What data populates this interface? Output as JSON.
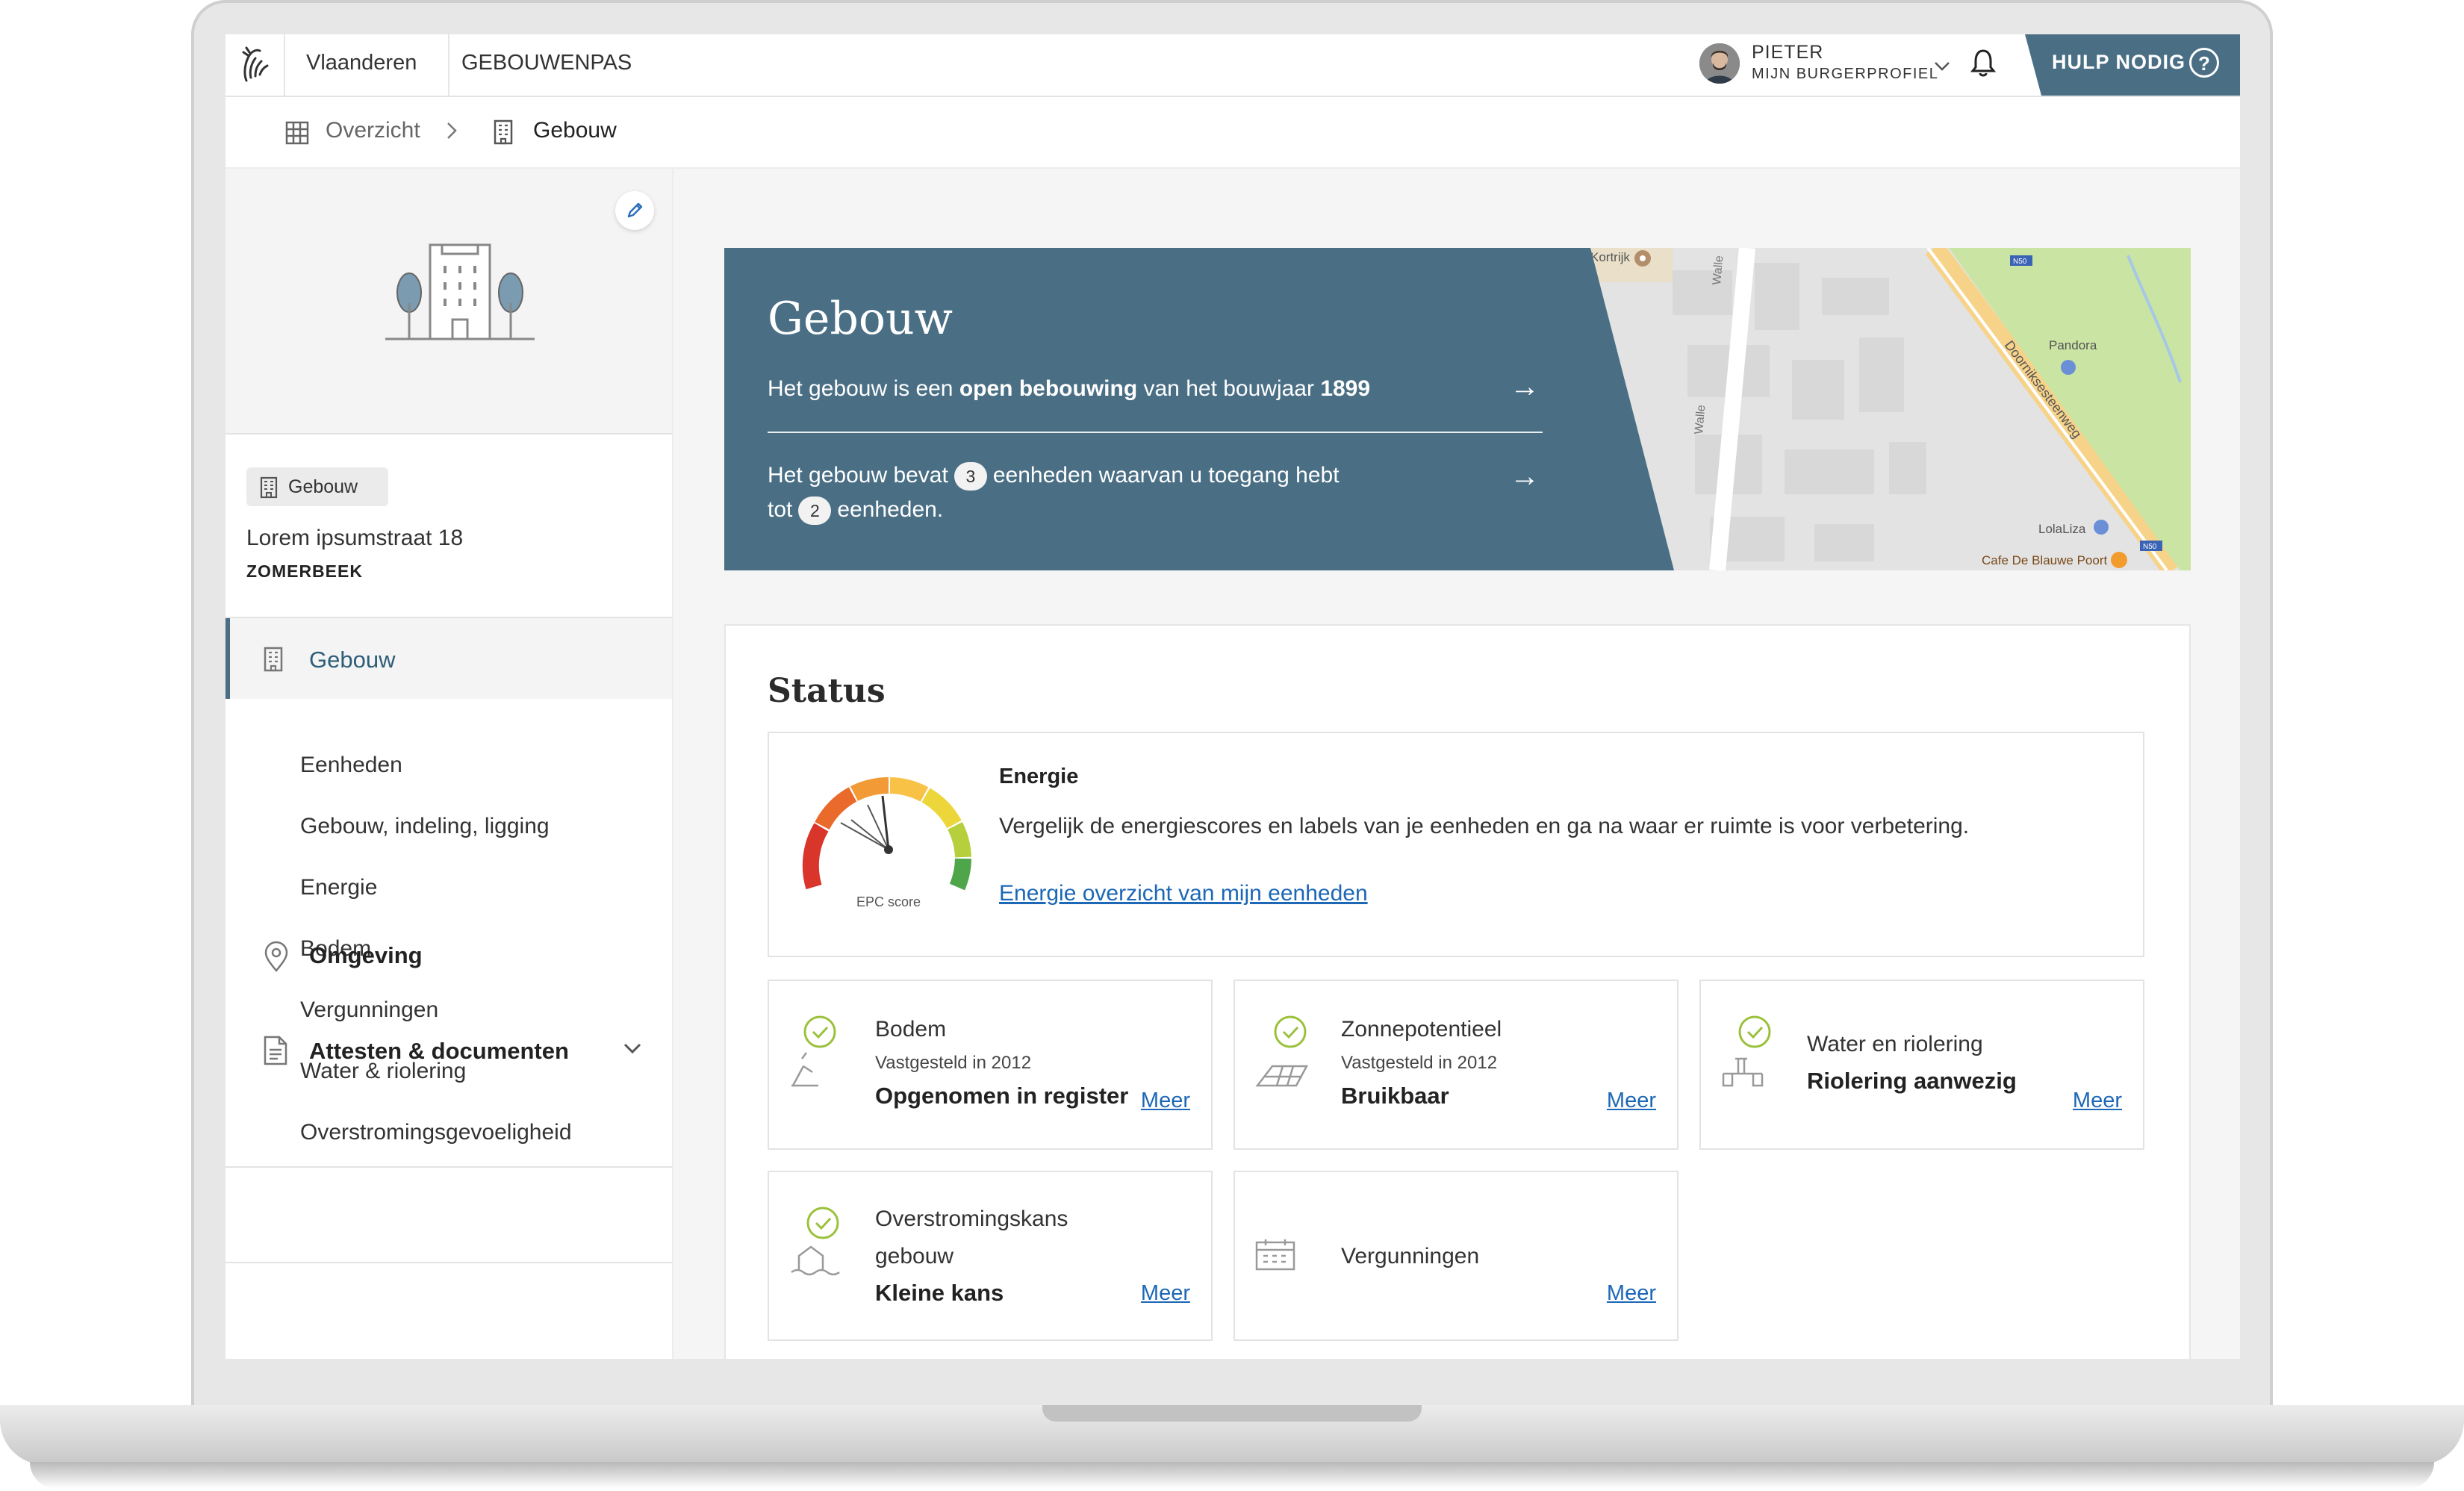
{
  "header": {
    "brand": "Vlaanderen",
    "app_name": "GEBOUWENPAS",
    "user_name": "PIETER",
    "user_profile": "MIJN BURGERPROFIEL",
    "help_label": "HULP NODIG",
    "help_icon": "?"
  },
  "breadcrumb": {
    "items": [
      {
        "label": "Overzicht",
        "icon": "grid-icon"
      },
      {
        "label": "Gebouw",
        "icon": "building-icon"
      }
    ]
  },
  "sidebar": {
    "tag": "Gebouw",
    "address": "Lorem ipsumstraat 18",
    "city": "ZOMERBEEK",
    "active_item": "Gebouw",
    "sub_items": [
      "Eenheden",
      "Gebouw, indeling, ligging",
      "Energie",
      "Bodem",
      "Vergunningen",
      "Water & riolering",
      "Overstromingsgevoeligheid"
    ],
    "omgeving": "Omgeving",
    "attesten": "Attesten & documenten"
  },
  "banner": {
    "title": "Gebouw",
    "line1_pre": "Het gebouw is een ",
    "line1_bold": "open bebouwing",
    "line1_mid": " van het bouwjaar ",
    "line1_year": "1899",
    "line2_pre": "Het gebouw bevat",
    "units_total": "3",
    "line2_mid": "eenheden waarvan u toegang hebt tot",
    "units_access": "2",
    "line2_post": "eenheden.",
    "map_labels": {
      "kortrijk": "Kortrijk",
      "walle1": "Walle",
      "walle2": "Walle",
      "road": "Doorniksesteenweg",
      "pandora": "Pandora",
      "lolaliza": "LolaLiza",
      "cafe": "Cafe De Blauwe Poort",
      "n50a": "N50",
      "n50b": "N50"
    }
  },
  "status": {
    "title": "Status",
    "energy": {
      "title": "Energie",
      "description": "Vergelijk de energiescores en labels van je eenheden en ga na waar er ruimte is voor verbetering.",
      "link": "Energie overzicht van mijn eenheden",
      "gauge_label": "EPC score"
    },
    "cards": [
      {
        "title": "Bodem",
        "subtitle": "Vastgesteld in 2012",
        "value": "Opgenomen in register",
        "link": "Meer"
      },
      {
        "title": "Zonnepotentieel",
        "subtitle": "Vastgesteld in 2012",
        "value": "Bruikbaar",
        "link": "Meer"
      },
      {
        "title": "Water en riolering",
        "value": "Riolering aanwezig",
        "link": "Meer"
      },
      {
        "title_line1": "Overstromingskans",
        "title_line2": "gebouw",
        "value": "Kleine kans",
        "link": "Meer"
      },
      {
        "title": "Vergunningen",
        "link": "Meer"
      }
    ]
  },
  "colors": {
    "primary": "#4a6f85",
    "link": "#1c67b6",
    "check": "#9bc13c"
  }
}
